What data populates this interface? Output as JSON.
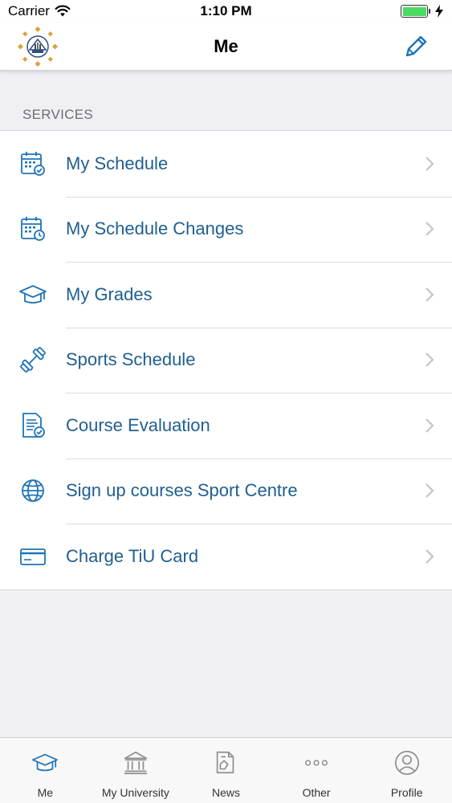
{
  "status_bar": {
    "carrier": "Carrier",
    "time": "1:10 PM",
    "battery_percent": 100
  },
  "nav": {
    "title": "Me"
  },
  "services": {
    "header": "SERVICES",
    "items": [
      {
        "label": "My Schedule",
        "icon": "calendar-check-icon"
      },
      {
        "label": "My Schedule Changes",
        "icon": "calendar-clock-icon"
      },
      {
        "label": "My Grades",
        "icon": "graduation-cap-icon"
      },
      {
        "label": "Sports Schedule",
        "icon": "dumbbell-icon"
      },
      {
        "label": "Course Evaluation",
        "icon": "document-check-icon"
      },
      {
        "label": "Sign up courses Sport Centre",
        "icon": "globe-icon"
      },
      {
        "label": "Charge TiU Card",
        "icon": "card-icon"
      }
    ]
  },
  "tab_bar": {
    "items": [
      {
        "label": "Me",
        "icon": "graduation-cap-icon",
        "active": true
      },
      {
        "label": "My University",
        "icon": "university-icon",
        "active": false
      },
      {
        "label": "News",
        "icon": "news-icon",
        "active": false
      },
      {
        "label": "Other",
        "icon": "more-dots-icon",
        "active": false
      },
      {
        "label": "Profile",
        "icon": "user-circle-icon",
        "active": false
      }
    ]
  },
  "colors": {
    "accent": "#1f74b8",
    "label": "#1f5f8f",
    "background": "#efeff4",
    "battery": "#4cd964",
    "logo_gold": "#d9a440"
  }
}
